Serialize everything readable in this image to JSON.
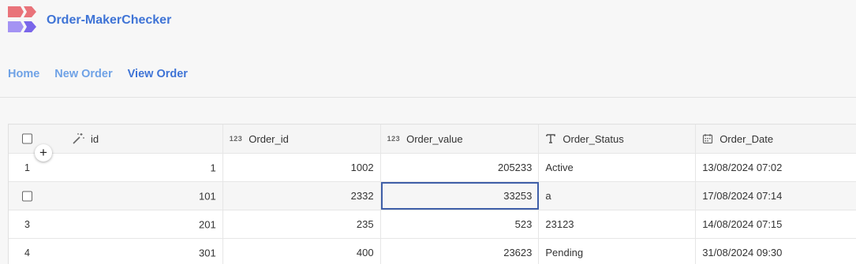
{
  "app": {
    "title": "Order-MakerChecker"
  },
  "nav": {
    "items": [
      {
        "label": "Home"
      },
      {
        "label": "New Order"
      },
      {
        "label": "View Order"
      }
    ]
  },
  "table": {
    "columns": [
      {
        "label": "id",
        "icon": "magic-wand-icon"
      },
      {
        "label": "Order_id",
        "icon": "123"
      },
      {
        "label": "Order_value",
        "icon": "123"
      },
      {
        "label": "Order_Status",
        "icon": "text-type-icon"
      },
      {
        "label": "Order_Date",
        "icon": "calendar-icon"
      }
    ],
    "rows": [
      {
        "row_num": "1",
        "id": "1",
        "order_id": "1002",
        "order_value": "205233",
        "status": "Active",
        "date": "13/08/2024 07:02"
      },
      {
        "row_num": "",
        "id": "101",
        "order_id": "2332",
        "order_value": "33253",
        "status": "a",
        "date": "17/08/2024 07:14"
      },
      {
        "row_num": "3",
        "id": "201",
        "order_id": "235",
        "order_value": "523",
        "status": "23123",
        "date": "14/08/2024 07:15"
      },
      {
        "row_num": "4",
        "id": "301",
        "order_id": "400",
        "order_value": "23623",
        "status": "Pending",
        "date": "31/08/2024 09:30"
      }
    ]
  },
  "colors": {
    "accent": "#3f74d6",
    "nav_light": "#6fa2e6",
    "logo_red": "#e9737a",
    "logo_purple": "#8a79ef"
  }
}
